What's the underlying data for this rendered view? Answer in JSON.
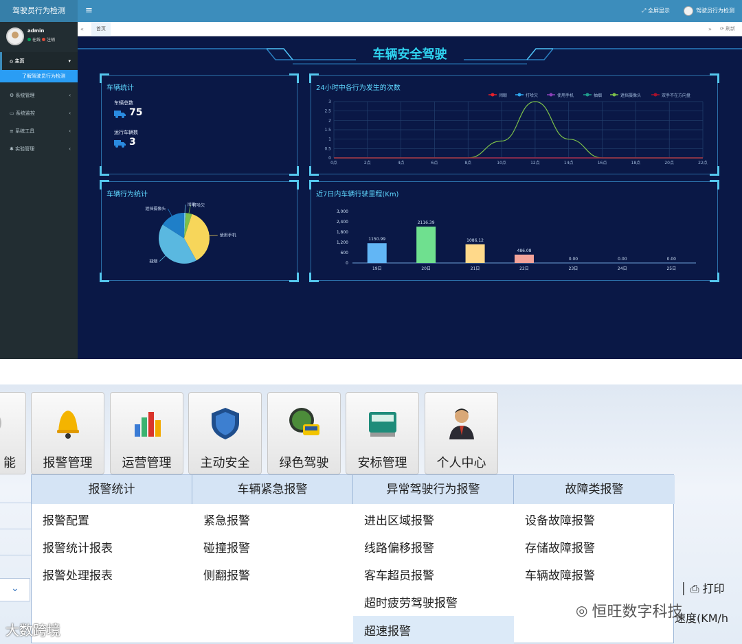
{
  "app": {
    "brand": "驾驶员行为检测",
    "menu_icon": "≡",
    "fullscreen": "全屏显示",
    "user_top": "驾驶员行为检测"
  },
  "sidebar": {
    "user": {
      "name": "admin",
      "status_online": "在线",
      "status_logout": "注销"
    },
    "items": [
      {
        "label": "主页",
        "icon": "home-icon"
      },
      {
        "label": "系统管理",
        "icon": "gear-icon"
      },
      {
        "label": "系统监控",
        "icon": "monitor-icon"
      },
      {
        "label": "系统工具",
        "icon": "tools-icon"
      },
      {
        "label": "实验管理",
        "icon": "flask-icon"
      }
    ],
    "sub_item": "了解驾驶员行为检测"
  },
  "tabs": {
    "home": "首页",
    "refresh": "刷新"
  },
  "dashboard": {
    "title": "车辆安全驾驶",
    "vehicle_stats": {
      "title": "车辆统计",
      "total_label": "车辆总数",
      "total_value": "75",
      "running_label": "运行车辆数",
      "running_value": "3"
    },
    "behavior_title": "车辆行为统计",
    "hourly_title": "24小时中各行为发生的次数",
    "mileage_title": "近7日内车辆行驶里程(Km)"
  },
  "chart_data": [
    {
      "type": "line",
      "title": "24小时中各行为发生的次数",
      "legend_position": "top-right",
      "x": [
        "0点",
        "2点",
        "4点",
        "6点",
        "8点",
        "10点",
        "12点",
        "14点",
        "16点",
        "18点",
        "20点",
        "22点"
      ],
      "ylim": [
        0,
        3
      ],
      "yticks": [
        "0",
        "0.5",
        "1",
        "1.5",
        "2",
        "2.5",
        "3"
      ],
      "series": [
        {
          "name": "闭眼",
          "color": "#e8212a",
          "values": [
            0,
            0,
            0,
            0,
            0,
            0,
            0,
            0,
            0,
            0,
            0,
            0
          ]
        },
        {
          "name": "打哈欠",
          "color": "#2fa8f0",
          "values": [
            0,
            0,
            0,
            0,
            0,
            0,
            0,
            0,
            0,
            0,
            0,
            0
          ]
        },
        {
          "name": "使用手机",
          "color": "#8a3fb8",
          "values": [
            0,
            0,
            0,
            0,
            0,
            0,
            0,
            0,
            0,
            0,
            0,
            0
          ]
        },
        {
          "name": "抽烟",
          "color": "#1f9c8c",
          "values": [
            0,
            0,
            0,
            0,
            0,
            0,
            0,
            0,
            0,
            0,
            0,
            0
          ]
        },
        {
          "name": "遮挡摄像头",
          "color": "#7cc04a",
          "values": [
            0,
            0,
            0,
            0,
            0,
            0.9,
            3,
            1,
            0,
            0,
            0,
            0
          ]
        },
        {
          "name": "双手不在方向盘",
          "color": "#a8102c",
          "values": [
            0,
            0,
            0,
            0,
            0,
            0,
            0,
            0,
            0,
            0,
            0,
            0
          ]
        }
      ]
    },
    {
      "type": "pie",
      "title": "车辆行为统计",
      "slices": [
        {
          "name": "闭眼",
          "value": 1,
          "color": "#6ec1e4"
        },
        {
          "name": "打哈欠",
          "value": 4,
          "color": "#7cc04a"
        },
        {
          "name": "使用手机",
          "value": 37,
          "color": "#f7d65a"
        },
        {
          "name": "抽烟",
          "value": 42,
          "color": "#5ab8e0"
        },
        {
          "name": "遮挡摄像头",
          "value": 16,
          "color": "#1f7fc8"
        }
      ]
    },
    {
      "type": "bar",
      "title": "近7日内车辆行驶里程(Km)",
      "categories": [
        "19日",
        "20日",
        "21日",
        "22日",
        "23日",
        "24日",
        "25日"
      ],
      "values": [
        1150.99,
        2116.39,
        1086.12,
        486.08,
        0,
        0,
        0
      ],
      "labels": [
        "1150.99",
        "2116.39",
        "1086.12",
        "486.08",
        "0.00",
        "0.00",
        "0.00"
      ],
      "colors": [
        "#62b6f5",
        "#6fe08f",
        "#ffd98a",
        "#f3a39a",
        "#62b6f5",
        "#62b6f5",
        "#62b6f5"
      ],
      "ylim": [
        0,
        3000
      ],
      "yticks": [
        "0",
        "600",
        "1,200",
        "1,800",
        "2,400",
        "3,000"
      ]
    }
  ],
  "bottom_menu": {
    "buttons": [
      {
        "label": "能",
        "icon": "gear-icon"
      },
      {
        "label": "报警管理",
        "icon": "bell-icon"
      },
      {
        "label": "运营管理",
        "icon": "bar-chart-icon"
      },
      {
        "label": "主动安全",
        "icon": "shield-icon"
      },
      {
        "label": "绿色驾驶",
        "icon": "bus-gauge-icon"
      },
      {
        "label": "安标管理",
        "icon": "device-icon"
      },
      {
        "label": "个人中心",
        "icon": "person-icon"
      }
    ],
    "dropdown": {
      "headers": [
        "报警统计",
        "车辆紧急报警",
        "异常驾驶行为报警",
        "故障类报警"
      ],
      "columns": [
        [
          "报警配置",
          "报警统计报表",
          "报警处理报表"
        ],
        [
          "紧急报警",
          "碰撞报警",
          "侧翻报警"
        ],
        [
          "进出区域报警",
          "线路偏移报警",
          "客车超员报警",
          "超时疲劳驾驶报警",
          "超速报警"
        ],
        [
          "设备故障报警",
          "存储故障报警",
          "车辆故障报警"
        ]
      ]
    },
    "print_label": "打印",
    "speed_label": "速度(KM/h",
    "watermark_wechat": "恒旺数字科技",
    "watermark_left": "大数跨境"
  }
}
